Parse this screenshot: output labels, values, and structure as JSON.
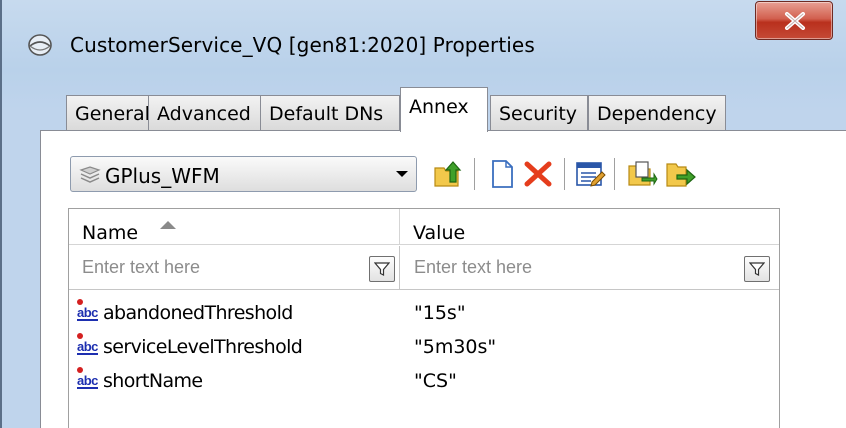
{
  "window": {
    "title": "CustomerService_VQ [gen81:2020] Properties"
  },
  "tabs": [
    {
      "label": "General",
      "active": false
    },
    {
      "label": "Advanced",
      "active": false
    },
    {
      "label": "Default DNs",
      "active": false
    },
    {
      "label": "Annex",
      "active": true
    },
    {
      "label": "Security",
      "active": false
    },
    {
      "label": "Dependency",
      "active": false
    }
  ],
  "annex": {
    "section_selector": {
      "selected": "GPlus_WFM",
      "icon": "sections-icon"
    },
    "toolbar": {
      "buttons": [
        {
          "name": "up-level-button",
          "icon": "up-folder-icon"
        },
        {
          "name": "new-button",
          "icon": "new-document-icon"
        },
        {
          "name": "delete-button",
          "icon": "delete-x-icon"
        },
        {
          "name": "edit-button",
          "icon": "edit-properties-icon"
        },
        {
          "name": "copy-button",
          "icon": "copy-icon"
        },
        {
          "name": "move-button",
          "icon": "move-icon"
        }
      ]
    },
    "grid": {
      "columns": {
        "name": "Name",
        "value": "Value"
      },
      "sort": {
        "column": "Name",
        "direction": "ascending"
      },
      "filter_placeholders": {
        "name": "Enter text here",
        "value": "Enter text here"
      },
      "rows": [
        {
          "icon": "string-option-icon",
          "icon_text": "abc",
          "name": "abandonedThreshold",
          "value": "\"15s\""
        },
        {
          "icon": "string-option-icon",
          "icon_text": "abc",
          "name": "serviceLevelThreshold",
          "value": "\"5m30s\""
        },
        {
          "icon": "string-option-icon",
          "icon_text": "abc",
          "name": "shortName",
          "value": "\"CS\""
        }
      ]
    }
  },
  "colors": {
    "window_frame": "#b9d1ea",
    "close_button": "#c7432f",
    "delete_icon": "#e53d1c",
    "abc_icon": "#1d2fb0"
  }
}
